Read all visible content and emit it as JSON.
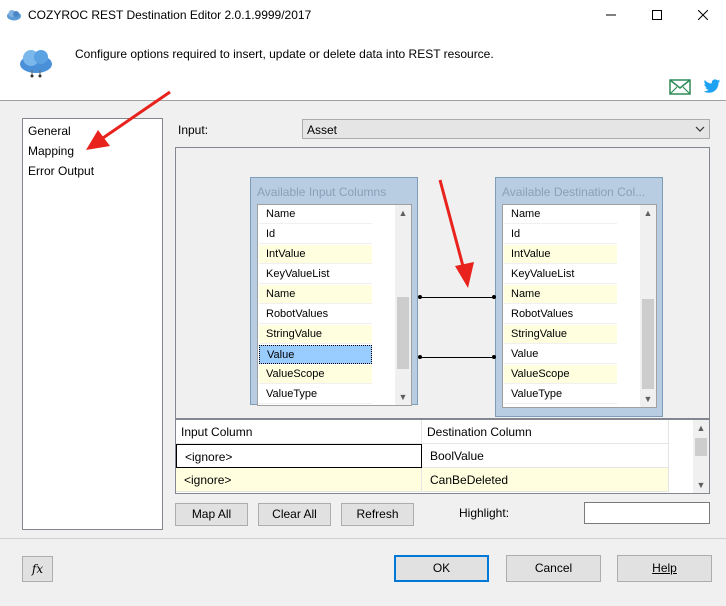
{
  "window": {
    "title": "COZYROC REST Destination Editor 2.0.1.9999/2017",
    "minimize": "—",
    "maximize": "☐",
    "close": "✕"
  },
  "header": {
    "description": "Configure options required to insert, update or delete data into REST resource.",
    "icons": [
      "cloud-icon",
      "email-icon",
      "twitter-icon"
    ]
  },
  "nav": {
    "items": [
      "General",
      "Mapping",
      "Error Output"
    ],
    "selected": "Mapping"
  },
  "input_label": "Input:",
  "input_value": "Asset",
  "available_input": {
    "title": "Available Input Columns",
    "header": "Name",
    "rows": [
      "Id",
      "IntValue",
      "KeyValueList",
      "Name",
      "RobotValues",
      "StringValue",
      "Value",
      "ValueScope",
      "ValueType"
    ],
    "selected": "Value"
  },
  "available_destination": {
    "title": "Available Destination Col...",
    "header": "Name",
    "rows": [
      "Id",
      "IntValue",
      "KeyValueList",
      "Name",
      "RobotValues",
      "StringValue",
      "Value",
      "ValueScope",
      "ValueType"
    ]
  },
  "mappings": [
    {
      "from": "Name",
      "to": "Name"
    },
    {
      "from": "Value",
      "to": "Value"
    }
  ],
  "grid": {
    "columns": [
      "Input Column",
      "Destination Column"
    ],
    "rows": [
      {
        "input": "<ignore>",
        "destination": "BoolValue"
      },
      {
        "input": "<ignore>",
        "destination": "CanBeDeleted"
      }
    ]
  },
  "buttons": {
    "map_all": "Map All",
    "clear_all": "Clear All",
    "refresh": "Refresh",
    "ok": "OK",
    "cancel": "Cancel",
    "help": "Help",
    "fx": "fx"
  },
  "highlight_label": "Highlight:",
  "highlight_value": "",
  "colors": {
    "annotation_arrow": "#e8221c",
    "selected_row": "#99ccff",
    "alt_row": "#ffffe0",
    "email_icon": "#2e8b57",
    "twitter_icon": "#1da1f2"
  }
}
